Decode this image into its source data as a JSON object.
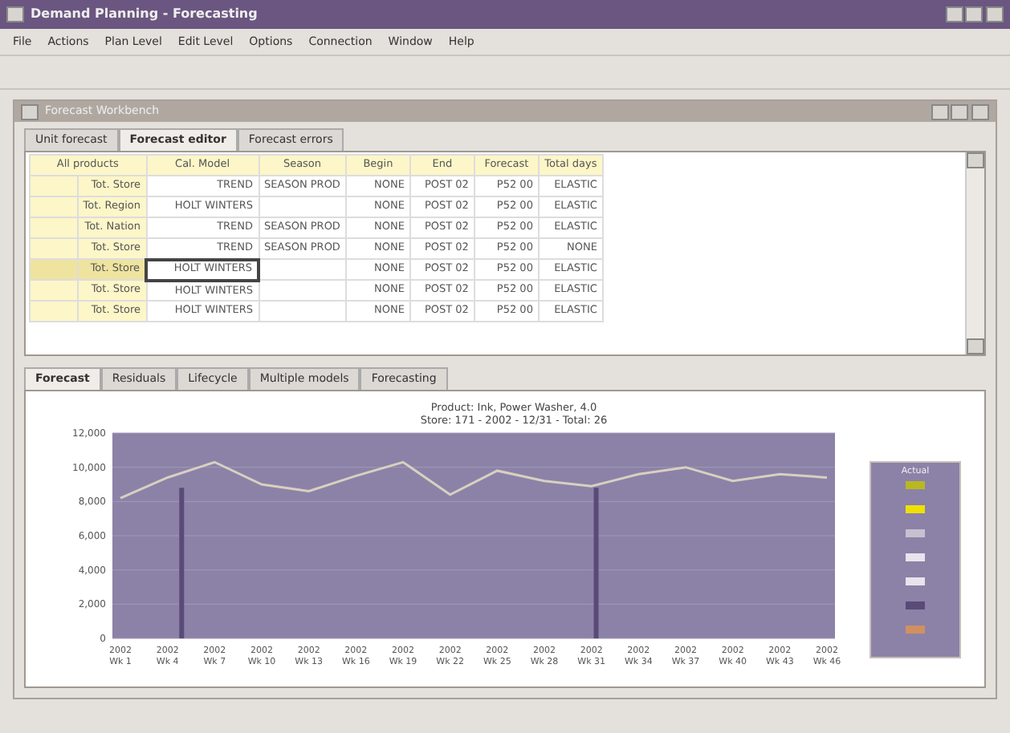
{
  "window": {
    "title": "Demand Planning - Forecasting"
  },
  "menu": [
    "File",
    "Actions",
    "Plan Level",
    "Edit Level",
    "Options",
    "Connection",
    "Window",
    "Help"
  ],
  "child_window": {
    "title": "Forecast Workbench"
  },
  "top_tabs": [
    {
      "label": "Unit forecast",
      "selected": false
    },
    {
      "label": "Forecast editor",
      "selected": true
    },
    {
      "label": "Forecast errors",
      "selected": false
    }
  ],
  "table": {
    "corner": "All products",
    "columns": [
      "Cal. Model",
      "Season",
      "Begin",
      "End",
      "Forecast",
      "Total days"
    ],
    "rows": [
      {
        "header": "Tot. Store",
        "cells": [
          "TREND",
          "SEASON PROD",
          "NONE",
          "POST 02",
          "P52 00",
          "ELASTIC"
        ],
        "selected": false
      },
      {
        "header": "Tot. Region",
        "cells": [
          "HOLT WINTERS",
          "",
          "NONE",
          "POST 02",
          "P52 00",
          "ELASTIC"
        ],
        "selected": false
      },
      {
        "header": "Tot. Nation",
        "cells": [
          "TREND",
          "SEASON PROD",
          "NONE",
          "POST 02",
          "P52 00",
          "ELASTIC"
        ],
        "selected": false
      },
      {
        "header": "Tot. Store",
        "cells": [
          "TREND",
          "SEASON PROD",
          "NONE",
          "POST 02",
          "P52 00",
          "NONE"
        ],
        "selected": false
      },
      {
        "header": "Tot. Store",
        "cells": [
          "HOLT WINTERS",
          "",
          "NONE",
          "POST 02",
          "P52 00",
          "ELASTIC"
        ],
        "selected": true
      },
      {
        "header": "Tot. Store",
        "cells": [
          "HOLT WINTERS",
          "",
          "NONE",
          "POST 02",
          "P52 00",
          "ELASTIC"
        ],
        "selected": false
      },
      {
        "header": "Tot. Store",
        "cells": [
          "HOLT WINTERS",
          "",
          "NONE",
          "POST 02",
          "P52 00",
          "ELASTIC"
        ],
        "selected": false
      }
    ]
  },
  "bottom_tabs": [
    {
      "label": "Forecast",
      "selected": true
    },
    {
      "label": "Residuals",
      "selected": false
    },
    {
      "label": "Lifecycle",
      "selected": false
    },
    {
      "label": "Multiple models",
      "selected": false
    },
    {
      "label": "Forecasting",
      "selected": false
    }
  ],
  "chart": {
    "title_lines": [
      "Product: Ink, Power Washer, 4.0",
      "Store: 171 - 2002 - 12/31 - Total: 26"
    ],
    "chart_data": {
      "type": "line",
      "categories": [
        "2002\nWk 1",
        "2002\nWk 4",
        "2002\nWk 7",
        "2002\nWk 10",
        "2002\nWk 13",
        "2002\nWk 16",
        "2002\nWk 19",
        "2002\nWk 22",
        "2002\nWk 25",
        "2002\nWk 28",
        "2002\nWk 31",
        "2002\nWk 34",
        "2002\nWk 37",
        "2002\nWk 40",
        "2002\nWk 43",
        "2002\nWk 46"
      ],
      "series": [
        {
          "name": "Actual",
          "color": "#d8d0c0",
          "values": [
            8200,
            9400,
            10300,
            9000,
            8600,
            9500,
            10300,
            8400,
            9800,
            9200,
            8900,
            9600,
            10000,
            9200,
            9600,
            9400
          ]
        }
      ],
      "ylim": [
        0,
        12000
      ],
      "grid": true,
      "yticks": [
        {
          "value": 0,
          "label": "0"
        },
        {
          "value": 2000,
          "label": "2,000"
        },
        {
          "value": 4000,
          "label": "4,000"
        },
        {
          "value": 6000,
          "label": "6,000"
        },
        {
          "value": 8000,
          "label": "8,000"
        },
        {
          "value": 10000,
          "label": "10,000"
        },
        {
          "value": 12000,
          "label": "12,000"
        }
      ]
    },
    "legend": [
      {
        "color": "#b8b820"
      },
      {
        "color": "#f0e000"
      },
      {
        "color": "#c8c0d0"
      },
      {
        "color": "#e8e4ec"
      },
      {
        "color": "#e8e4ec"
      },
      {
        "color": "#5a4a78"
      },
      {
        "color": "#d09060"
      }
    ]
  }
}
